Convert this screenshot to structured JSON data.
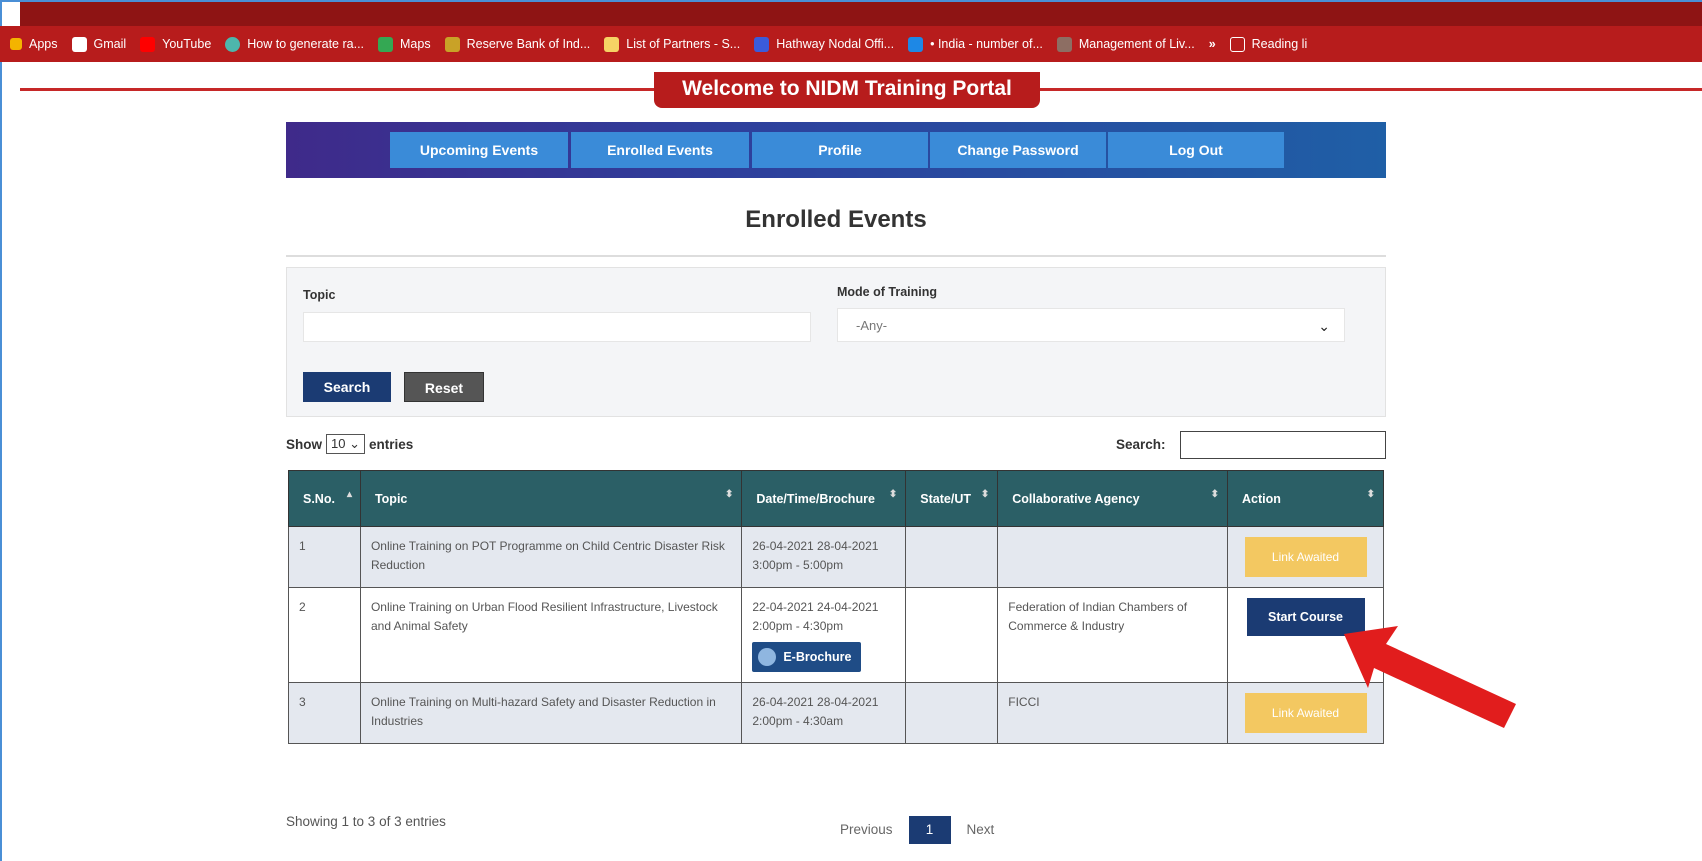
{
  "bookmarks": [
    {
      "label": "Apps",
      "icon": "apps-icon",
      "color": "#f4b400"
    },
    {
      "label": "Gmail",
      "icon": "gmail-icon",
      "color": "#ffffff"
    },
    {
      "label": "YouTube",
      "icon": "youtube-icon",
      "color": "#ff0000"
    },
    {
      "label": "How to generate ra...",
      "icon": "globe-icon",
      "color": "#4db6ac"
    },
    {
      "label": "Maps",
      "icon": "maps-icon",
      "color": "#34a853"
    },
    {
      "label": "Reserve Bank of Ind...",
      "icon": "rbi-icon",
      "color": "#c9a227"
    },
    {
      "label": "List of Partners - S...",
      "icon": "partners-icon",
      "color": "#f6d365"
    },
    {
      "label": "Hathway Nodal Offi...",
      "icon": "hathway-icon",
      "color": "#3b5bdb"
    },
    {
      "label": "• India - number of...",
      "icon": "chart-icon",
      "color": "#1e88e5"
    },
    {
      "label": "Management of Liv...",
      "icon": "doc-icon",
      "color": "#8d6e63"
    },
    {
      "label": "»",
      "icon": "",
      "color": ""
    },
    {
      "label": "Reading li",
      "icon": "reading-list-icon",
      "color": "#ffffff"
    }
  ],
  "welcome_banner": "Welcome to NIDM Training Portal",
  "nav": [
    "Upcoming Events",
    "Enrolled Events",
    "Profile",
    "Change Password",
    "Log Out"
  ],
  "page_title": "Enrolled Events",
  "filter": {
    "topic_label": "Topic",
    "topic_value": "",
    "mode_label": "Mode of Training",
    "mode_value": "-Any-",
    "search_button": "Search",
    "reset_button": "Reset"
  },
  "table_controls": {
    "show_label": "Show",
    "entries_value": "10",
    "entries_label": "entries",
    "search_label": "Search:",
    "search_value": ""
  },
  "columns": [
    "S.No.",
    "Topic",
    "Date/Time/Brochure",
    "State/UT",
    "Collaborative Agency",
    "Action"
  ],
  "rows": [
    {
      "sno": "1",
      "topic": "Online Training on POT Programme on Child Centric Disaster Risk Reduction",
      "date": "26-04-2021 28-04-2021",
      "time": "3:00pm - 5:00pm",
      "state": "",
      "agency": "",
      "action": "Link Awaited",
      "brochure": ""
    },
    {
      "sno": "2",
      "topic": "Online Training on Urban Flood Resilient Infrastructure, Livestock and Animal Safety",
      "date": "22-04-2021 24-04-2021",
      "time": "2:00pm - 4:30pm",
      "state": "",
      "agency": "Federation of Indian Chambers of Commerce & Industry",
      "action": "Start Course",
      "brochure": "E-Brochure"
    },
    {
      "sno": "3",
      "topic": "Online Training on Multi-hazard Safety and Disaster Reduction in Industries",
      "date": "26-04-2021 28-04-2021",
      "time": "2:00pm - 4:30am",
      "state": "",
      "agency": "FICCI",
      "action": "Link Awaited",
      "brochure": ""
    }
  ],
  "footer": {
    "showing": "Showing 1 to 3 of 3 entries",
    "previous": "Previous",
    "page": "1",
    "next": "Next"
  },
  "colors": {
    "banner_red": "#b71c1c",
    "nav_button": "#3a8bd8",
    "table_header": "#2b5f66",
    "primary_dark": "#1b3b73",
    "link_awaited": "#f3c861",
    "annotation_arrow": "#e11d1d"
  }
}
